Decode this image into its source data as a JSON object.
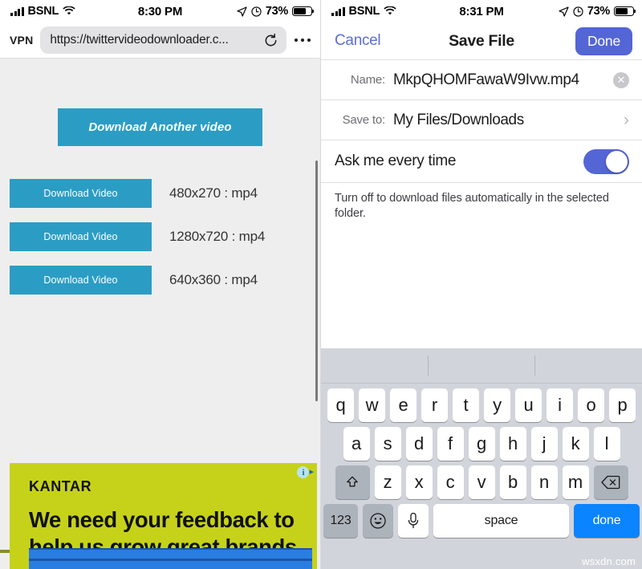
{
  "left": {
    "status_bar": {
      "carrier": "BSNL",
      "wifi_icon": "wifi-icon",
      "time": "8:30 PM",
      "location_icon": "location-arrow-icon",
      "alarm_icon": "orientation-lock-icon",
      "battery_percent": "73%",
      "battery_level": 73
    },
    "browser": {
      "vpn_label": "VPN",
      "url": "https://twittervideodownloader.c...",
      "reload_icon": "reload-icon",
      "more_icon": "more-dots-icon"
    },
    "page": {
      "primary_button": "Download Another video",
      "downloads": [
        {
          "button": "Download Video",
          "resolution": "480x270 : mp4"
        },
        {
          "button": "Download Video",
          "resolution": "1280x720 : mp4"
        },
        {
          "button": "Download Video",
          "resolution": "640x360 : mp4"
        }
      ],
      "ad": {
        "adchoices_icon": "adchoices-info-icon",
        "adchoices_arrow": "▸",
        "brand": "KANTAR",
        "headline": "We need your feedback to help us grow great brands.",
        "background_color": "#c6d21a",
        "cta_color": "#2a7de1"
      },
      "accent_color": "#2b9dc4",
      "background_color": "#eeeeee"
    }
  },
  "right": {
    "status_bar": {
      "carrier": "BSNL",
      "wifi_icon": "wifi-icon",
      "time": "8:31 PM",
      "location_icon": "location-arrow-icon",
      "alarm_icon": "orientation-lock-icon",
      "battery_percent": "73%",
      "battery_level": 73
    },
    "navbar": {
      "cancel": "Cancel",
      "title": "Save File",
      "done": "Done",
      "done_color": "#5465d6"
    },
    "form": {
      "name_label": "Name:",
      "name_value": "MkpQHOMFawaW9Ivw.mp4",
      "clear_icon": "clear-circle-icon",
      "saveto_label": "Save to:",
      "saveto_value": "My Files/Downloads",
      "chevron_icon": "chevron-right-icon",
      "toggle_label": "Ask me every time",
      "toggle_on": true,
      "toggle_color": "#5465d6",
      "footnote": "Turn off to download files automatically in the selected folder."
    },
    "keyboard": {
      "row1": [
        "q",
        "w",
        "e",
        "r",
        "t",
        "y",
        "u",
        "i",
        "o",
        "p"
      ],
      "row2": [
        "a",
        "s",
        "d",
        "f",
        "g",
        "h",
        "j",
        "k",
        "l"
      ],
      "row3": [
        "z",
        "x",
        "c",
        "v",
        "b",
        "n",
        "m"
      ],
      "shift_icon": "shift-arrow-icon",
      "backspace_icon": "backspace-icon",
      "numbers_key": "123",
      "emoji_icon": "emoji-smiley-icon",
      "mic_icon": "microphone-icon",
      "space_key": "space",
      "done_key": "done",
      "done_key_color": "#0b84ff"
    }
  },
  "watermark": "wsxdn.com"
}
